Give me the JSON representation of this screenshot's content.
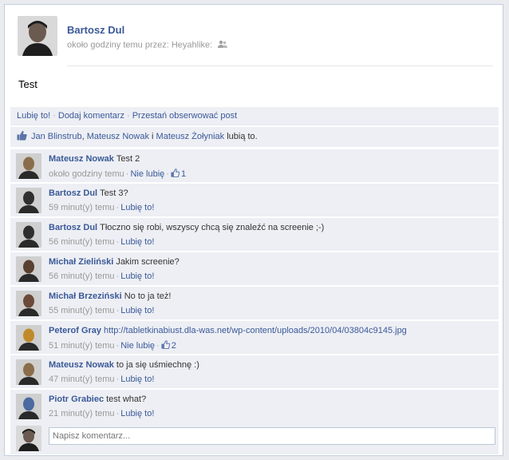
{
  "post": {
    "author": "Bartosz Dul",
    "meta": "około godziny temu przez: Heyahlike:",
    "meta_icon": "friends-icon",
    "text": "Test"
  },
  "actions": {
    "like": "Lubię to!",
    "comment": "Dodaj komentarz",
    "unfollow": "Przestań obserwować post",
    "separator": "·"
  },
  "likes": {
    "name1": "Jan Blinstrub",
    "sep1": ", ",
    "name2": "Mateusz Nowak",
    "sep2": " i ",
    "name3": "Mateusz Żołyniak",
    "suffix": " lubią to."
  },
  "comments": [
    {
      "author": "Mateusz Nowak",
      "text": "Test 2",
      "link": "",
      "time": "około godziny temu",
      "action": "Nie lubię",
      "likes": "1",
      "avatar_color": "#8a6d4a"
    },
    {
      "author": "Bartosz Dul",
      "text": "Test 3?",
      "link": "",
      "time": "59 minut(y) temu",
      "action": "Lubię to!",
      "likes": "",
      "avatar_color": "#2f2f2f"
    },
    {
      "author": "Bartosz Dul",
      "text": "Tłoczno się robi, wszyscy chcą się znaleźć na screenie ;-)",
      "link": "",
      "time": "56 minut(y) temu",
      "action": "Lubię to!",
      "likes": "",
      "avatar_color": "#2f2f2f"
    },
    {
      "author": "Michał Zieliński",
      "text": "Jakim screenie?",
      "link": "",
      "time": "56 minut(y) temu",
      "action": "Lubię to!",
      "likes": "",
      "avatar_color": "#5a4030"
    },
    {
      "author": "Michał Brzeziński",
      "text": "No to ja też!",
      "link": "",
      "time": "55 minut(y) temu",
      "action": "Lubię to!",
      "likes": "",
      "avatar_color": "#6b4a3a"
    },
    {
      "author": "Peterof Gray",
      "text": "",
      "link": "http://tabletkinabiust.dla-was.net/wp-content/uploads/2010/04/03804c9145.jpg",
      "time": "51 minut(y) temu",
      "action": "Nie lubię",
      "likes": "2",
      "avatar_color": "#c08a2a"
    },
    {
      "author": "Mateusz Nowak",
      "text": "to ja się uśmiechnę :)",
      "link": "",
      "time": "47 minut(y) temu",
      "action": "Lubię to!",
      "likes": "",
      "avatar_color": "#8a6d4a"
    },
    {
      "author": "Piotr Grabiec",
      "text": "test what?",
      "link": "",
      "time": "21 minut(y) temu",
      "action": "Lubię to!",
      "likes": "",
      "avatar_color": "#4a6aa0"
    }
  ],
  "composer": {
    "placeholder": "Napisz komentarz..."
  },
  "colors": {
    "link": "#3b5998",
    "panel": "#edeff4",
    "muted": "#999999"
  }
}
